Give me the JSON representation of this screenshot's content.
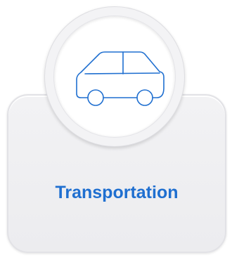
{
  "category": {
    "label": "Transportation",
    "icon": "car-icon",
    "accent_color": "#1f6fd0"
  }
}
